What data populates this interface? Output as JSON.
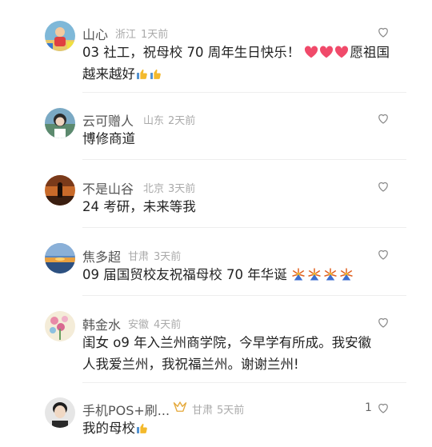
{
  "comments": [
    {
      "name": "山心",
      "location": "浙江",
      "time": "1天前",
      "text_line1": "03 社工，祝母校 70 周年生日快乐！",
      "text_line1_tail": "愿祖国",
      "text_line2": "越来越好",
      "avatar": "child-avatar"
    },
    {
      "name": "云可赠人",
      "location": "山东",
      "time": "2天前",
      "text": "博修商道",
      "avatar": "girl-avatar"
    },
    {
      "name": "不是山谷",
      "location": "北京",
      "time": "3天前",
      "text": "24 考研，未来等我",
      "avatar": "sunset-figure-avatar"
    },
    {
      "name": "焦多超",
      "location": "甘肃",
      "time": "3天前",
      "text": "09 届国贸校友祝福母校 70 年华诞",
      "avatar": "seascape-avatar"
    },
    {
      "name": "韩金水",
      "location": "安徽",
      "time": "4天前",
      "text_line1": "闺女 o9 年入兰州商学院，今早学有所成。我安徽",
      "text_line2": "人我爱兰州，我祝福兰州。谢谢兰州!",
      "avatar": "flowers-avatar"
    },
    {
      "name": "手机POS+刷...",
      "location": "甘肃",
      "time": "5天前",
      "text": "我的母校",
      "likes": "1",
      "avatar": "man-avatar"
    }
  ],
  "colors": {
    "heart_red": "#f04a6a",
    "meta_grey": "#aaaaaa",
    "badge_gold": "#e5a93b"
  }
}
